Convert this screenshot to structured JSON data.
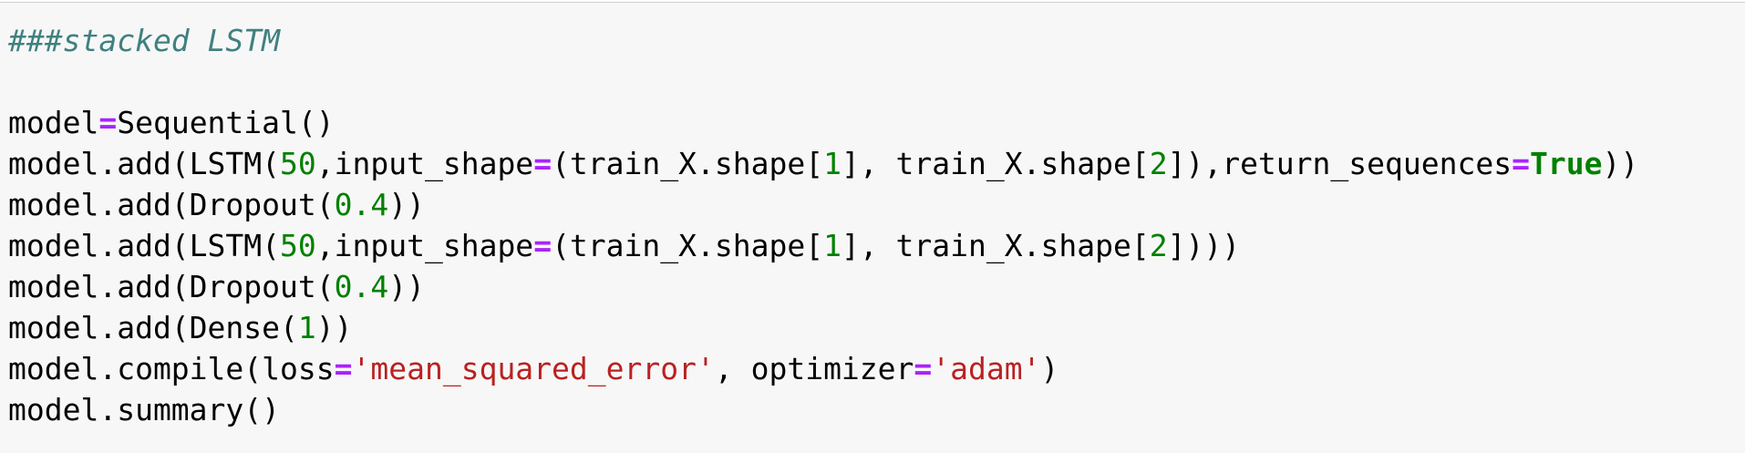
{
  "cell": {
    "lines": [
      [
        {
          "t": "###stacked LSTM",
          "k": "comment"
        }
      ],
      [],
      [
        {
          "t": "model",
          "k": "plain"
        },
        {
          "t": "=",
          "k": "op"
        },
        {
          "t": "Sequential()",
          "k": "plain"
        }
      ],
      [
        {
          "t": "model.add(LSTM(",
          "k": "plain"
        },
        {
          "t": "50",
          "k": "num"
        },
        {
          "t": ",input_shape",
          "k": "plain"
        },
        {
          "t": "=",
          "k": "op"
        },
        {
          "t": "(train_X.shape[",
          "k": "plain"
        },
        {
          "t": "1",
          "k": "num"
        },
        {
          "t": "], train_X.shape[",
          "k": "plain"
        },
        {
          "t": "2",
          "k": "num"
        },
        {
          "t": "]),return_sequences",
          "k": "plain"
        },
        {
          "t": "=",
          "k": "op"
        },
        {
          "t": "True",
          "k": "kw"
        },
        {
          "t": "))",
          "k": "plain"
        }
      ],
      [
        {
          "t": "model.add(Dropout(",
          "k": "plain"
        },
        {
          "t": "0.4",
          "k": "num"
        },
        {
          "t": "))",
          "k": "plain"
        }
      ],
      [
        {
          "t": "model.add(LSTM(",
          "k": "plain"
        },
        {
          "t": "50",
          "k": "num"
        },
        {
          "t": ",input_shape",
          "k": "plain"
        },
        {
          "t": "=",
          "k": "op"
        },
        {
          "t": "(train_X.shape[",
          "k": "plain"
        },
        {
          "t": "1",
          "k": "num"
        },
        {
          "t": "], train_X.shape[",
          "k": "plain"
        },
        {
          "t": "2",
          "k": "num"
        },
        {
          "t": "])))",
          "k": "plain"
        }
      ],
      [
        {
          "t": "model.add(Dropout(",
          "k": "plain"
        },
        {
          "t": "0.4",
          "k": "num"
        },
        {
          "t": "))",
          "k": "plain"
        }
      ],
      [
        {
          "t": "model.add(Dense(",
          "k": "plain"
        },
        {
          "t": "1",
          "k": "num"
        },
        {
          "t": "))",
          "k": "plain"
        }
      ],
      [
        {
          "t": "model.compile(loss",
          "k": "plain"
        },
        {
          "t": "=",
          "k": "op"
        },
        {
          "t": "'mean_squared_error'",
          "k": "str"
        },
        {
          "t": ", optimizer",
          "k": "plain"
        },
        {
          "t": "=",
          "k": "op"
        },
        {
          "t": "'adam'",
          "k": "str"
        },
        {
          "t": ")",
          "k": "plain"
        }
      ],
      [
        {
          "t": "model.summary()",
          "k": "plain"
        }
      ]
    ]
  },
  "colors": {
    "background": "#f7f7f7",
    "comment": "#408080",
    "operator": "#aa22ff",
    "number": "#008000",
    "keyword": "#008000",
    "string": "#ba2121",
    "text": "#000000"
  }
}
